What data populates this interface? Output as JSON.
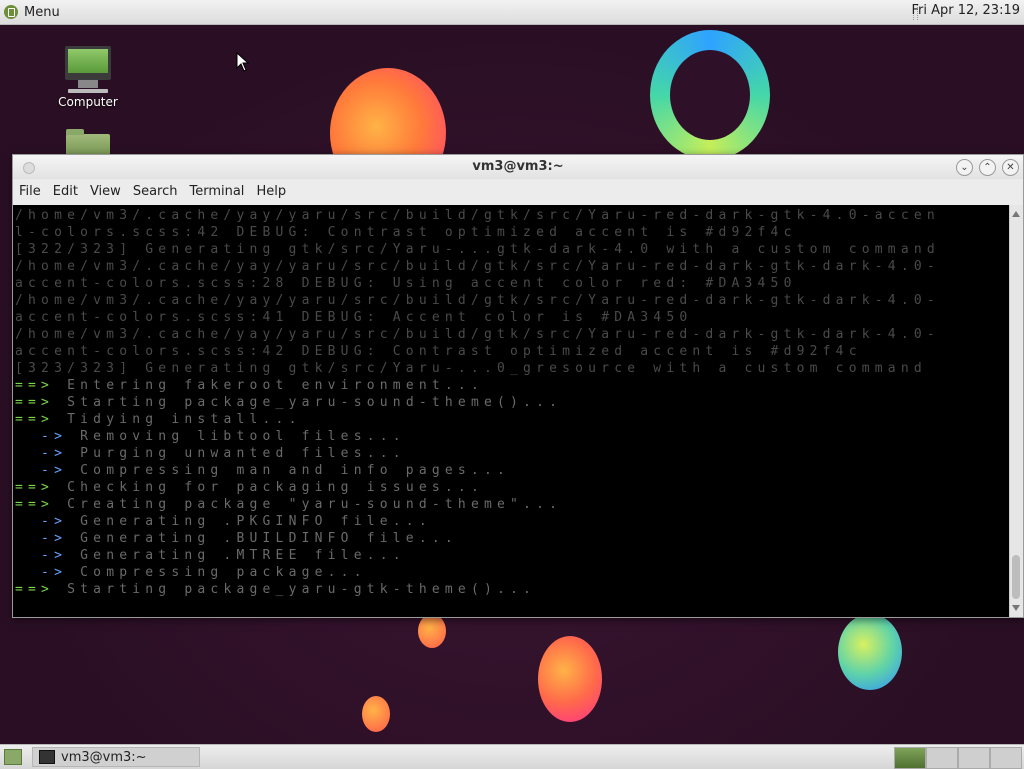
{
  "top_panel": {
    "menu_label": "Menu",
    "clock": "Fri Apr 12, 23:19"
  },
  "desktop": {
    "icons": [
      {
        "label": "Computer"
      }
    ]
  },
  "window": {
    "title": "vm3@vm3:~",
    "menu": [
      "File",
      "Edit",
      "View",
      "Search",
      "Terminal",
      "Help"
    ],
    "terminal_lines": [
      {
        "style": "dim",
        "prefix": "",
        "text": "/home/vm3/.cache/yay/yaru/src/build/gtk/src/Yaru-red-dark-gtk-4.0-accen"
      },
      {
        "style": "dim",
        "prefix": "",
        "text": "l-colors.scss:42 DEBUG: Contrast optimized accent is #d92f4c"
      },
      {
        "style": "dim",
        "prefix": "",
        "text": "[322/323] Generating gtk/src/Yaru-...gtk-dark-4.0 with a custom command"
      },
      {
        "style": "dim",
        "prefix": "",
        "text": "/home/vm3/.cache/yay/yaru/src/build/gtk/src/Yaru-red-dark-gtk-dark-4.0-"
      },
      {
        "style": "dim",
        "prefix": "",
        "text": "accent-colors.scss:28 DEBUG: Using accent color red: #DA3450"
      },
      {
        "style": "dim",
        "prefix": "",
        "text": "/home/vm3/.cache/yay/yaru/src/build/gtk/src/Yaru-red-dark-gtk-dark-4.0-"
      },
      {
        "style": "dim",
        "prefix": "",
        "text": "accent-colors.scss:41 DEBUG: Accent color is #DA3450"
      },
      {
        "style": "dim",
        "prefix": "",
        "text": "/home/vm3/.cache/yay/yaru/src/build/gtk/src/Yaru-red-dark-gtk-dark-4.0-"
      },
      {
        "style": "dim",
        "prefix": "",
        "text": "accent-colors.scss:42 DEBUG: Contrast optimized accent is #d92f4c"
      },
      {
        "style": "dim",
        "prefix": "",
        "text": "[323/323] Generating gtk/src/Yaru-...0_gresource with a custom command"
      },
      {
        "style": "grey",
        "prefix": "==>",
        "color": "arrow-g",
        "text": " Entering fakeroot environment..."
      },
      {
        "style": "grey",
        "prefix": "==>",
        "color": "arrow-g",
        "text": " Starting package_yaru-sound-theme()..."
      },
      {
        "style": "grey",
        "prefix": "==>",
        "color": "arrow-g",
        "text": " Tidying install..."
      },
      {
        "style": "grey",
        "prefix": "  ->",
        "color": "arrow-b",
        "text": " Removing libtool files..."
      },
      {
        "style": "grey",
        "prefix": "  ->",
        "color": "arrow-b",
        "text": " Purging unwanted files..."
      },
      {
        "style": "grey",
        "prefix": "  ->",
        "color": "arrow-b",
        "text": " Compressing man and info pages..."
      },
      {
        "style": "grey",
        "prefix": "==>",
        "color": "arrow-g",
        "text": " Checking for packaging issues..."
      },
      {
        "style": "grey",
        "prefix": "==>",
        "color": "arrow-g",
        "text": " Creating package \"yaru-sound-theme\"..."
      },
      {
        "style": "grey",
        "prefix": "  ->",
        "color": "arrow-b",
        "text": " Generating .PKGINFO file..."
      },
      {
        "style": "grey",
        "prefix": "  ->",
        "color": "arrow-b",
        "text": " Generating .BUILDINFO file..."
      },
      {
        "style": "grey",
        "prefix": "  ->",
        "color": "arrow-b",
        "text": " Generating .MTREE file..."
      },
      {
        "style": "grey",
        "prefix": "  ->",
        "color": "arrow-b",
        "text": " Compressing package..."
      },
      {
        "style": "grey",
        "prefix": "==>",
        "color": "arrow-g",
        "text": " Starting package_yaru-gtk-theme()..."
      }
    ]
  },
  "taskbar": {
    "task_label": "vm3@vm3:~"
  }
}
